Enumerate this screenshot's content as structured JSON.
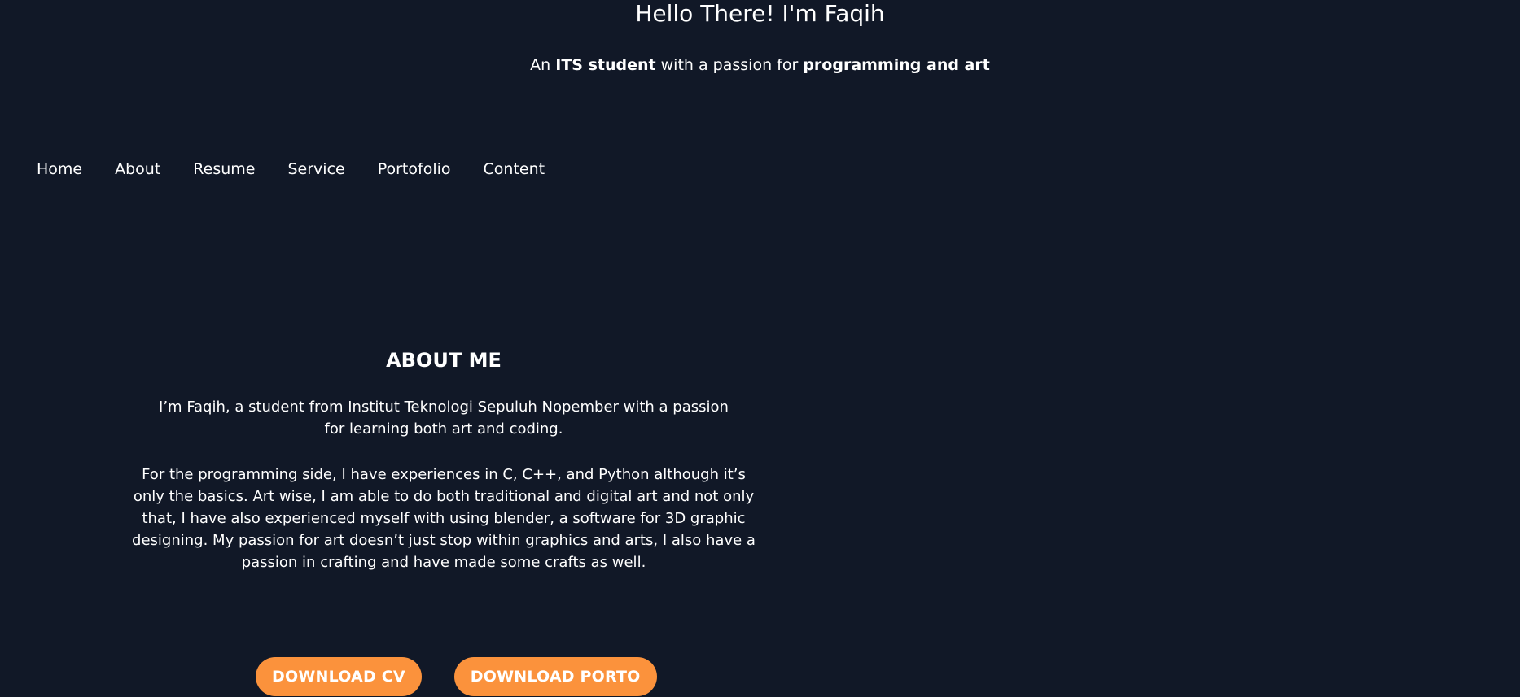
{
  "hero": {
    "title": "Hello There! I'm Faqih",
    "subtitle_prefix": "An ",
    "subtitle_bold1": "ITS student",
    "subtitle_middle": " with a passion for ",
    "subtitle_bold2": "programming and art"
  },
  "nav": {
    "items": [
      "Home",
      "About",
      "Resume",
      "Service",
      "Portofolio",
      "Content"
    ]
  },
  "about": {
    "heading": "ABOUT ME",
    "paragraph1": "I’m Faqih, a student from Institut Teknologi Sepuluh Nopember with a passion for learning both art and coding.",
    "paragraph2": "For the programming side, I have experiences in C, C++, and Python although it’s only the basics. Art wise, I am able to do both traditional and digital art and not only that, I have also experienced myself with using blender, a software for 3D graphic designing. My passion for art doesn’t just stop within graphics and arts, I also have a passion in crafting and have made some crafts as well."
  },
  "buttons": {
    "download_cv": "DOWNLOAD CV",
    "download_porto": "DOWNLOAD PORTO"
  },
  "colors": {
    "background": "#111827",
    "accent": "#fb923c",
    "text": "#ffffff"
  }
}
